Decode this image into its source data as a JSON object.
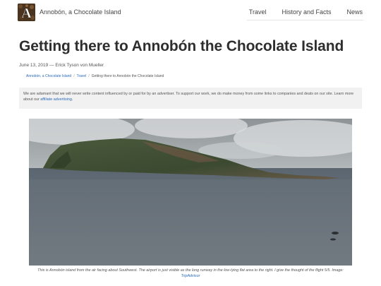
{
  "header": {
    "site_title": "Annobón, a Chocolate Island",
    "logo_letter": "A",
    "nav": [
      {
        "label": "Travel"
      },
      {
        "label": "History and Facts"
      },
      {
        "label": "News"
      }
    ]
  },
  "article": {
    "title": "Getting there to Annobón the Chocolate Island",
    "date": "June 13, 2019",
    "dash": " — ",
    "author": "Erick Tyson von Mueller"
  },
  "breadcrumb": {
    "items": [
      "Annobón, a Chocolate Island",
      "Travel",
      "Getting there to Annobón the Chocolate Island"
    ],
    "separator": "/"
  },
  "disclosure": {
    "text": "We are adamant that we will never write content influenced by or paid for by an advertiser. To support our work, we do make money from some links to companies and deals on our site. Learn more about our ",
    "link": "affiliate advertising",
    "end": "."
  },
  "photo": {
    "caption_text": "This is Annobón island from the air facing about Southwest. The airport is just visible as the long runway in the low-lying flat area to the right. I give the thought of the flight 5/5. Image: ",
    "caption_link": "TripAdvisor"
  },
  "colors": {
    "link": "#2a6ab8",
    "title": "#2e2e2e",
    "disclosure_bg": "#f1f1f1"
  },
  "icons": {
    "logo": "chocolate-island-logo-icon"
  }
}
